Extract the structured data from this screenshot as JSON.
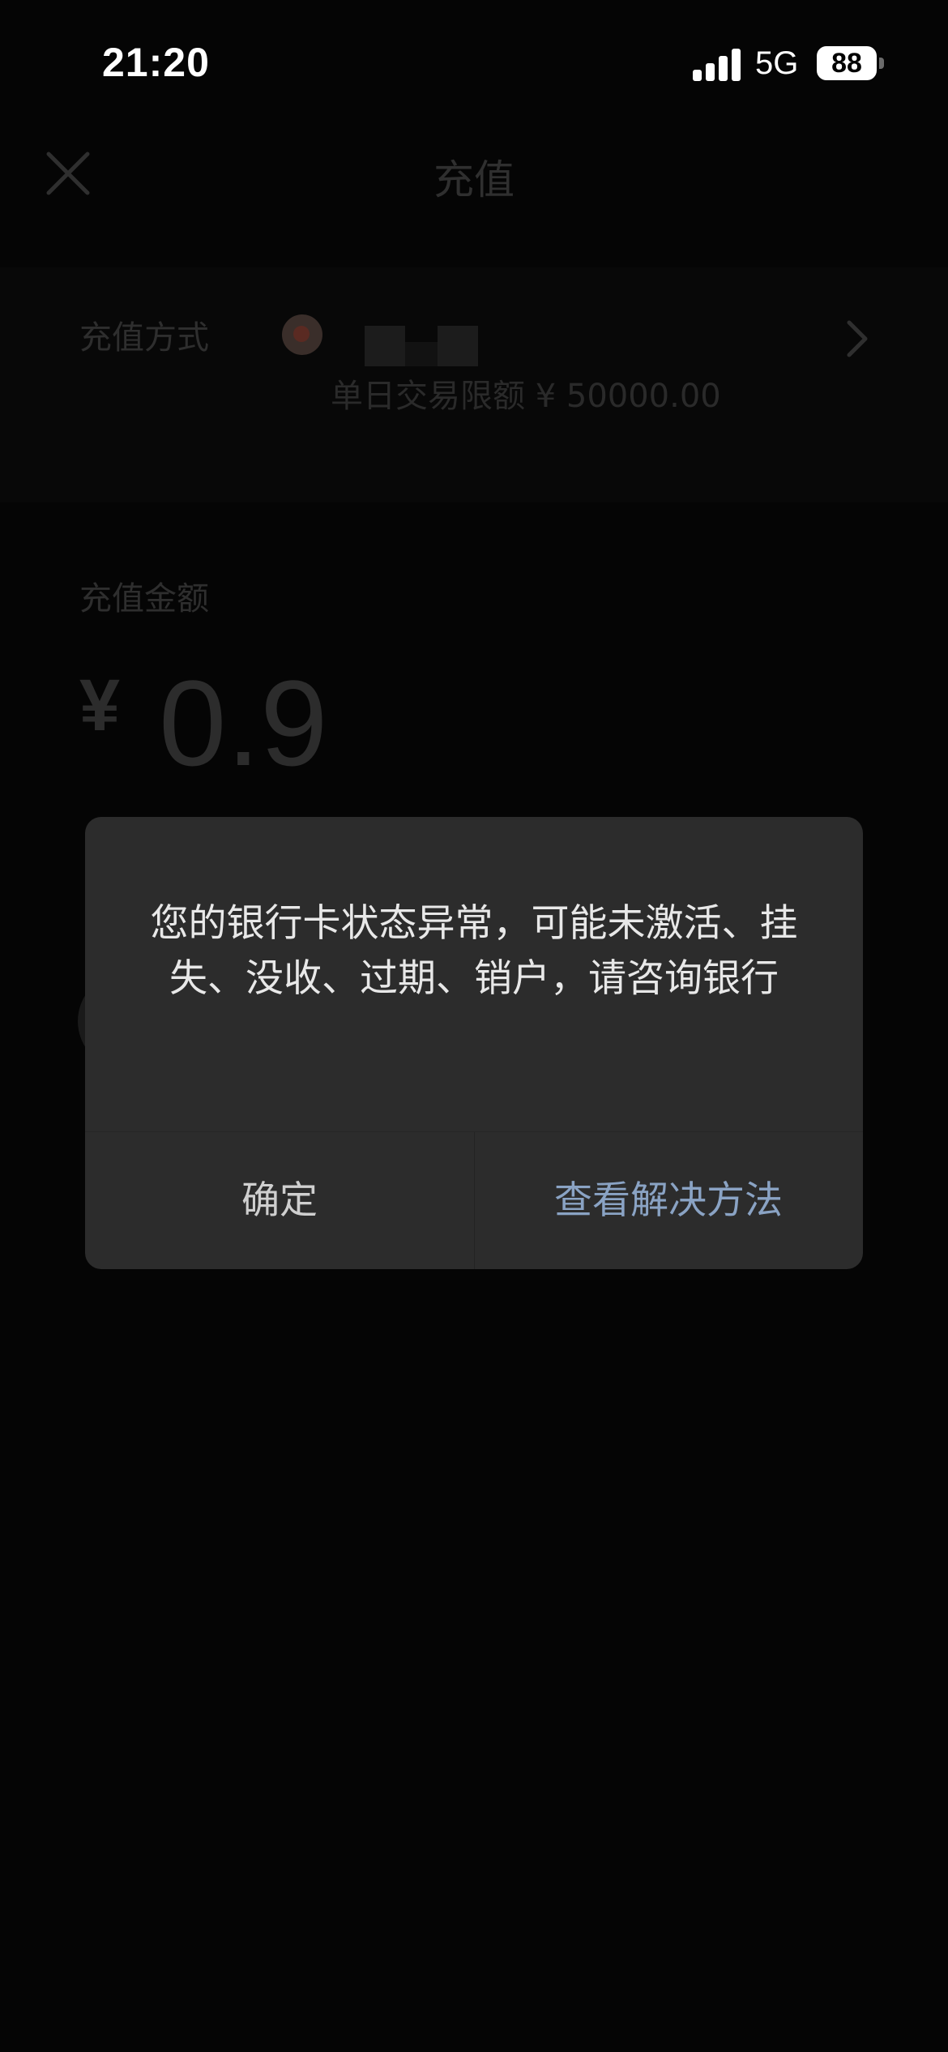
{
  "status_bar": {
    "time": "21:20",
    "network": "5G",
    "battery": "88",
    "icons": [
      "signal-icon",
      "battery-icon"
    ]
  },
  "nav": {
    "title": "充值",
    "close_icon": "close-icon"
  },
  "recharge_method": {
    "label": "充值方式",
    "limit_text": "单日交易限额 ¥ 50000.00",
    "chevron_icon": "chevron-right-icon"
  },
  "amount": {
    "label": "充值金额",
    "currency": "¥",
    "value": "0.9"
  },
  "dialog": {
    "message": "您的银行卡状态异常，可能未激活、挂失、没收、过期、销户，请咨询银行",
    "confirm_label": "确定",
    "solution_label": "查看解决方法"
  },
  "colors": {
    "background": "#050505",
    "dialog_background": "#2c2c2c",
    "link_color": "#8aa3c4"
  }
}
